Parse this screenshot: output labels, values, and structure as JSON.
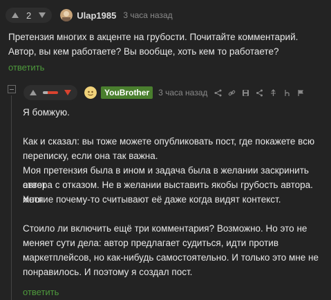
{
  "comment1": {
    "score": "2",
    "username": "Ulap1985",
    "time": "3 часа назад",
    "lines": [
      "Претензия многих в акценте на грубости. Почитайте комментарий.",
      "Автор, вы кем работаете? Вы вообще, хоть кем то работаете?"
    ],
    "reply": "ответить"
  },
  "comment2": {
    "username": "YouBrother",
    "time": "3 часа назад",
    "lines": [
      "Я бомжую.",
      "",
      "Как и сказал: вы тоже можете опубликовать пост, где покажете всю",
      "переписку, если она так важна.",
      "Моя претензия была в ином и задача была в желании заскринить ответ",
      "автора с отказом. Не в желании выставить якобы грубость автора. Хотя",
      "многие почему-то считывают её даже когда видят контекст.",
      "",
      "Стоило ли включить ещё три комментария? Возможно. Но это не",
      "меняет сути дела: автор предлагает судиться, идти против",
      "маркетплейсов, но как-нибудь самостоятельно. И только это мне не",
      "понравилось. И поэтому я создал пост."
    ],
    "reply": "ответить",
    "actions": [
      "share-nodes-icon",
      "link-icon",
      "save-icon",
      "share-icon",
      "pin-icon",
      "h-icon",
      "flag-icon"
    ]
  },
  "colors": {
    "background": "#232323",
    "reply_link": "#4e9a3c",
    "badge": "#4a7f2e",
    "downvote_active": "#d9432f"
  }
}
